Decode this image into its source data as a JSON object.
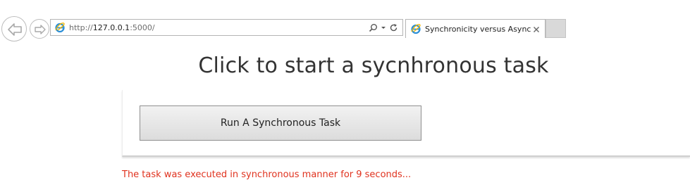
{
  "browser": {
    "address": {
      "scheme": "http://",
      "host": "127.0.0.1",
      "rest": ":5000/"
    },
    "tab": {
      "title": "Synchronicity versus Async..."
    },
    "icons": {
      "back": "back-arrow-icon",
      "forward": "forward-arrow-icon",
      "site": "internet-explorer-icon",
      "search": "search-icon",
      "dropdown": "chevron-down-icon",
      "refresh": "refresh-icon",
      "close": "close-icon"
    }
  },
  "page": {
    "heading": "Click to start a sycnhronous task",
    "run_button_label": "Run A Synchronous Task",
    "status_message": "The task was executed in synchronous manner for 9 seconds...",
    "status_color": "#e0321e"
  }
}
